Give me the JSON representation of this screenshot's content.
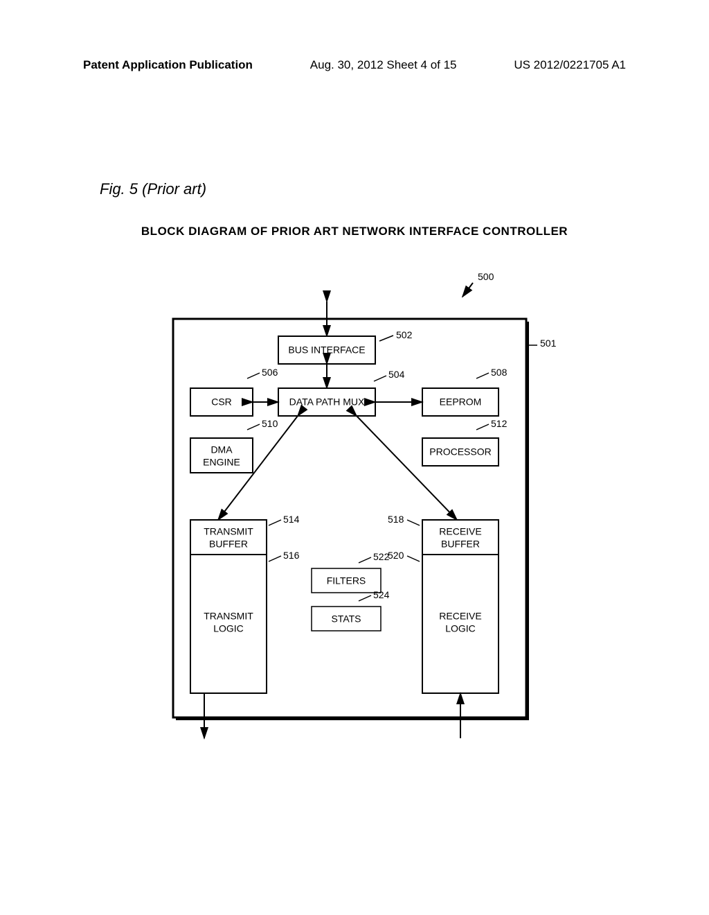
{
  "header": {
    "left": "Patent Application Publication",
    "mid": "Aug. 30, 2012  Sheet 4 of 15",
    "right": "US 2012/0221705 A1"
  },
  "figure_label": "Fig. 5 (Prior art)",
  "diagram_title": "BLOCK DIAGRAM OF PRIOR ART NETWORK INTERFACE CONTROLLER",
  "refs": {
    "r500": "500",
    "r501": "501",
    "r502": "502",
    "r504": "504",
    "r506": "506",
    "r508": "508",
    "r510": "510",
    "r512": "512",
    "r514": "514",
    "r516": "516",
    "r518": "518",
    "r520": "520",
    "r522": "522",
    "r524": "524"
  },
  "blocks": {
    "bus_interface": "BUS INTERFACE",
    "csr": "CSR",
    "data_path_mux": "DATA PATH MUX",
    "eeprom": "EEPROM",
    "dma_engine_l1": "DMA",
    "dma_engine_l2": "ENGINE",
    "processor": "PROCESSOR",
    "transmit_buffer_l1": "TRANSMIT",
    "transmit_buffer_l2": "BUFFER",
    "receive_buffer_l1": "RECEIVE",
    "receive_buffer_l2": "BUFFER",
    "transmit_logic_l1": "TRANSMIT",
    "transmit_logic_l2": "LOGIC",
    "receive_logic_l1": "RECEIVE",
    "receive_logic_l2": "LOGIC",
    "filters": "FILTERS",
    "stats": "STATS"
  }
}
